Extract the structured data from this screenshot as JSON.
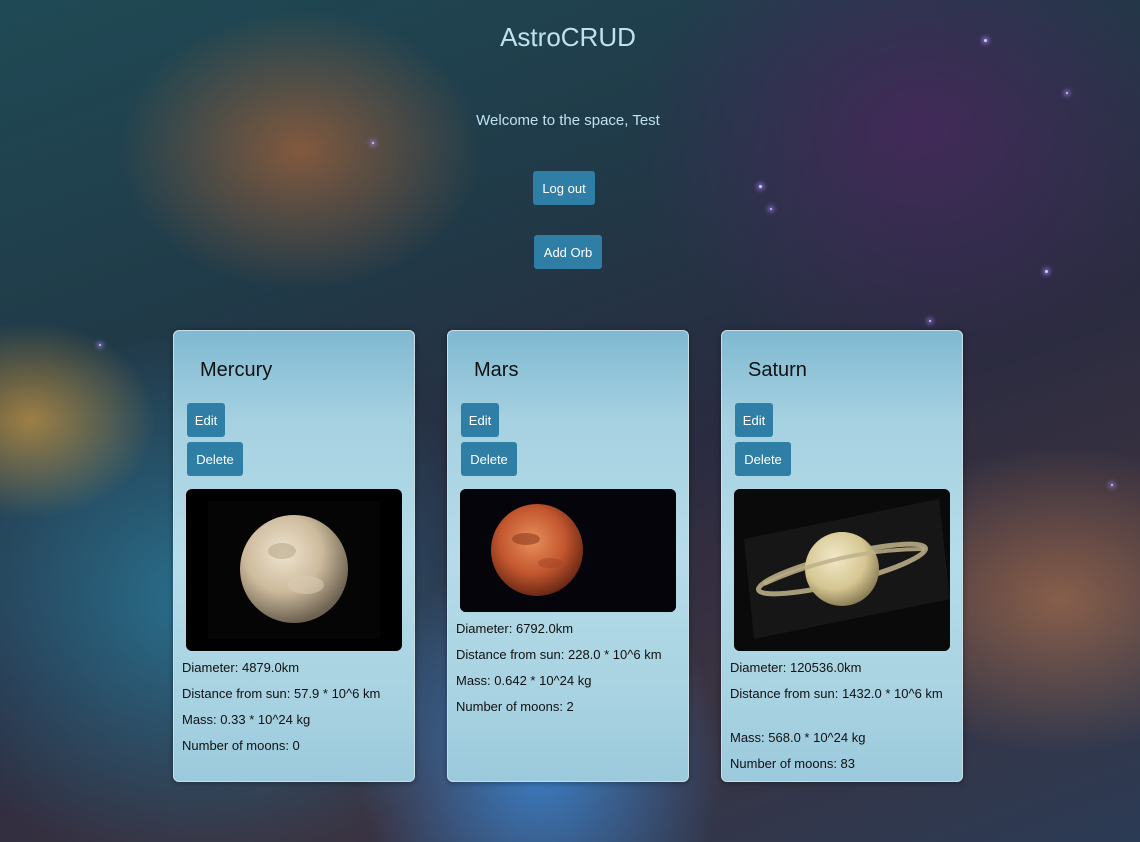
{
  "app": {
    "title": "AstroCRUD",
    "welcome": "Welcome to the space, Test"
  },
  "actions": {
    "logout_label": "Log out",
    "add_label": "Add Orb"
  },
  "orbs": [
    {
      "name": "Mercury",
      "edit_label": "Edit",
      "delete_label": "Delete",
      "diameter": "Diameter: 4879.0km",
      "distance": "Distance from sun: 57.9 * 10^6 km",
      "mass": "Mass: 0.33 * 10^24 kg",
      "moons": "Number of moons: 0"
    },
    {
      "name": "Mars",
      "edit_label": "Edit",
      "delete_label": "Delete",
      "diameter": "Diameter: 6792.0km",
      "distance": "Distance from sun: 228.0 * 10^6 km",
      "mass": "Mass: 0.642 * 10^24 kg",
      "moons": "Number of moons: 2"
    },
    {
      "name": "Saturn",
      "edit_label": "Edit",
      "delete_label": "Delete",
      "diameter": "Diameter: 120536.0km",
      "distance": "Distance from sun: 1432.0 * 10^6 km",
      "mass": "Mass: 568.0 * 10^24 kg",
      "moons": "Number of moons: 83"
    }
  ],
  "colors": {
    "button": "#2f7ea6",
    "title": "#bfe1f0"
  }
}
